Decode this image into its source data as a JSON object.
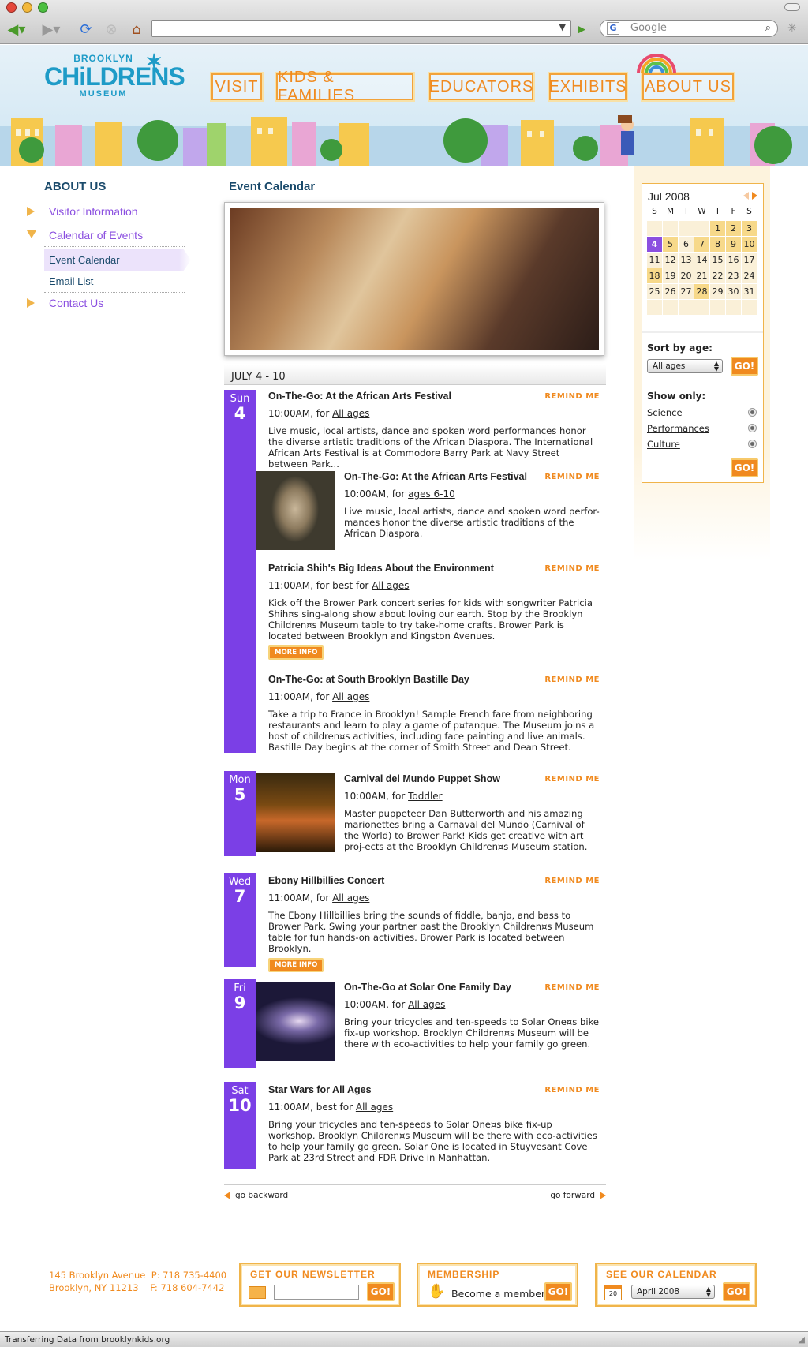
{
  "browser": {
    "search_placeholder": "Google",
    "status": "Transferring Data from brooklynkids.org"
  },
  "logo": {
    "line1": "BROOKLYN",
    "line2": "CHiLDRENS",
    "line3": "MUSEUM"
  },
  "nav": [
    "VISIT",
    "KIDS & FAMILIES",
    "EDUCATORS",
    "EXHIBITS",
    "ABOUT US"
  ],
  "left": {
    "heading": "ABOUT US",
    "items": [
      "Visitor Information",
      "Calendar of Events",
      "Contact Us"
    ],
    "sub": [
      "Event Calendar",
      "Email List"
    ]
  },
  "main": {
    "heading": "Event Calendar",
    "range": "JULY 4 - 10"
  },
  "days": [
    {
      "dow": "Sun",
      "num": "4"
    },
    {
      "dow": "Mon",
      "num": "5"
    },
    {
      "dow": "Wed",
      "num": "7"
    },
    {
      "dow": "Fri",
      "num": "9"
    },
    {
      "dow": "Sat",
      "num": "10"
    }
  ],
  "remind": "REMIND ME",
  "more": "MORE INFO",
  "events": [
    {
      "title": "On-The-Go: At the African Arts Festival",
      "time_pre": "10:00AM, for ",
      "age": "All ages",
      "desc": "Live music, local artists, dance and spoken word performances honor the diverse artistic traditions of the African Diaspora. The International African Arts Festival is at Commodore Barry Park at Navy Street between Park..."
    },
    {
      "title": "On-The-Go: At the African Arts Festival",
      "time_pre": "10:00AM, for ",
      "age": "ages 6-10",
      "desc": "Live music, local artists, dance and spoken word perfor-mances honor the diverse artistic traditions of the African Diaspora."
    },
    {
      "title": "Patricia Shih's Big Ideas About the Environment",
      "time_pre": "11:00AM, for best for ",
      "age": "All ages",
      "desc": "Kick off the Brower Park concert series for kids with songwriter Patricia Shih¤s sing-along show about loving our earth. Stop by the Brooklyn Children¤s Museum table to try take-home crafts. Brower Park is located between Brooklyn and Kingston Avenues."
    },
    {
      "title": "On-The-Go: at South Brooklyn Bastille Day",
      "time_pre": "11:00AM, for ",
      "age": "All ages",
      "desc": "Take a trip to France in Brooklyn! Sample French fare from neighboring restaurants and learn to play a game of p¤tanque. The Museum joins a host of children¤s activities, including face painting and live animals. Bastille Day begins at the corner of Smith Street and Dean Street."
    },
    {
      "title": "Carnival del Mundo Puppet Show",
      "time_pre": "10:00AM, for ",
      "age": "Toddler",
      "desc": "Master puppeteer Dan Butterworth and his amazing marionettes bring a Carnaval del Mundo (Carnival of the World) to Brower Park! Kids get creative with art proj-ects at the Brooklyn Children¤s Museum station."
    },
    {
      "title": "Ebony Hillbillies Concert",
      "time_pre": "11:00AM, for ",
      "age": "All ages",
      "desc": "The Ebony Hillbillies bring the sounds of fiddle, banjo, and bass to Brower Park. Swing your partner past the Brooklyn Children¤s Museum table for fun hands-on activities. Brower Park is located between Brooklyn."
    },
    {
      "title": "On-The-Go at Solar One Family Day",
      "time_pre": "10:00AM, for ",
      "age": "All ages",
      "desc": "Bring your tricycles and ten-speeds to Solar One¤s bike fix-up workshop. Brooklyn Children¤s Museum will be there with eco-activities to help your family go green."
    },
    {
      "title": "Star Wars for All Ages",
      "time_pre": "11:00AM, best for ",
      "age": "All ages",
      "desc": "Bring your tricycles and ten-speeds to Solar One¤s bike fix-up workshop. Brooklyn Children¤s Museum will be there with eco-activities to help your family go green. Solar One is located in Stuyvesant Cove Park at 23rd Street and FDR Drive in Manhattan."
    }
  ],
  "pager": {
    "back": "go backward",
    "fwd": "go forward"
  },
  "cal": {
    "month": "Jul 2008",
    "dow": [
      "S",
      "M",
      "T",
      "W",
      "T",
      "F",
      "S"
    ],
    "cells": [
      "",
      "",
      "",
      "",
      "1",
      "2",
      "3",
      "4",
      "5",
      "6",
      "7",
      "8",
      "9",
      "10",
      "11",
      "12",
      "13",
      "14",
      "15",
      "16",
      "17",
      "18",
      "19",
      "20",
      "21",
      "22",
      "23",
      "24",
      "25",
      "26",
      "27",
      "28",
      "29",
      "30",
      "31",
      "",
      "",
      "",
      "",
      "",
      "",
      ""
    ],
    "event_days": [
      "1",
      "2",
      "3",
      "5",
      "7",
      "8",
      "9",
      "10",
      "18",
      "28"
    ],
    "today": "4"
  },
  "sort": {
    "label": "Sort by age:",
    "value": "All ages",
    "go": "GO!"
  },
  "show": {
    "label": "Show only:",
    "opts": [
      "Science",
      "Performances",
      "Culture"
    ],
    "go": "GO!"
  },
  "footer": {
    "addr1": "145 Brooklyn Avenue",
    "phone": "P: 718 735-4400",
    "addr2": "Brooklyn, NY 11213",
    "fax": "F: 718 604-7442",
    "newsletter": "GET OUR NEWSLETTER",
    "membership": "MEMBERSHIP",
    "member_text": "Become a member",
    "calendar": "SEE OUR CALENDAR",
    "cal_value": "April 2008",
    "cal_day": "20",
    "go": "GO!"
  },
  "colors": {
    "accent": "#f08a1f",
    "purple": "#7b3fe6",
    "navy": "#1a4a6b"
  }
}
